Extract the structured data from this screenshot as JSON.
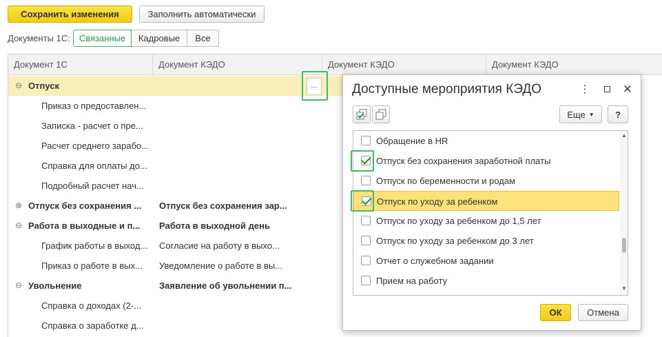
{
  "toolbar": {
    "save_label": "Сохранить изменения",
    "autofill_label": "Заполнить автоматически"
  },
  "filter": {
    "label": "Документы 1С:",
    "options": [
      "Связанные",
      "Кадровые",
      "Все"
    ],
    "selected": "Связанные"
  },
  "table": {
    "headers": [
      "Документ 1С",
      "Документ КЭДО",
      "Документ КЭДО",
      "Документ КЭДО"
    ],
    "rows": [
      {
        "doc1c": "Отпуск",
        "kedo": "",
        "group": true,
        "toggle": "⊖",
        "bold": true,
        "selected": true
      },
      {
        "doc1c": "Приказ о предоставлен...",
        "kedo": "",
        "group": false
      },
      {
        "doc1c": "Записка - расчет о пре...",
        "kedo": "",
        "group": false
      },
      {
        "doc1c": "Расчет среднего зарабо...",
        "kedo": "",
        "group": false
      },
      {
        "doc1c": "Справка для оплаты до...",
        "kedo": "",
        "group": false
      },
      {
        "doc1c": "Подробный расчет нач...",
        "kedo": "",
        "group": false
      },
      {
        "doc1c": "Отпуск без сохранения ...",
        "kedo": "Отпуск без сохранения зар...",
        "group": true,
        "toggle": "⊕",
        "bold": true
      },
      {
        "doc1c": "Работа в выходные и п...",
        "kedo": "Работа в выходной день",
        "group": true,
        "toggle": "⊖",
        "bold": true
      },
      {
        "doc1c": "График работы в выход...",
        "kedo": "Согласие на работу в выхо...",
        "group": false
      },
      {
        "doc1c": "Приказ о работе в вых...",
        "kedo": "Уведомление о работе в вы...",
        "group": false
      },
      {
        "doc1c": "Увольнение",
        "kedo": "Заявление об увольнении п...",
        "group": true,
        "toggle": "⊖",
        "bold": true
      },
      {
        "doc1c": "Справка о доходах (2-...",
        "kedo": "",
        "group": false
      },
      {
        "doc1c": "Справка о заработке д...",
        "kedo": "",
        "group": false
      }
    ],
    "ellipsis_label": "..."
  },
  "dialog": {
    "title": "Доступные мероприятия КЭДО",
    "more_label": "Еще",
    "help_label": "?",
    "items": [
      {
        "label": "Обращение в HR",
        "checked": false
      },
      {
        "label": "Отпуск без сохранения заработной платы",
        "checked": true
      },
      {
        "label": "Отпуск по беременности и родам",
        "checked": false
      },
      {
        "label": "Отпуск по уходу за ребенком",
        "checked": true,
        "selected": true
      },
      {
        "label": "Отпуск по уходу за ребенком до 1,5 лет",
        "checked": false
      },
      {
        "label": "Отпуск по уходу за ребенком до 3 лет",
        "checked": false
      },
      {
        "label": "Отчет о служебном задании",
        "checked": false
      },
      {
        "label": "Прием на работу",
        "checked": false
      }
    ],
    "ok_label": "ОК",
    "cancel_label": "Отмена"
  },
  "colors": {
    "accent_yellow": "#f5d21c",
    "selection_row": "#fbefb9",
    "highlight_green": "#3dbb65",
    "active_filter_green": "#2c8f46"
  }
}
